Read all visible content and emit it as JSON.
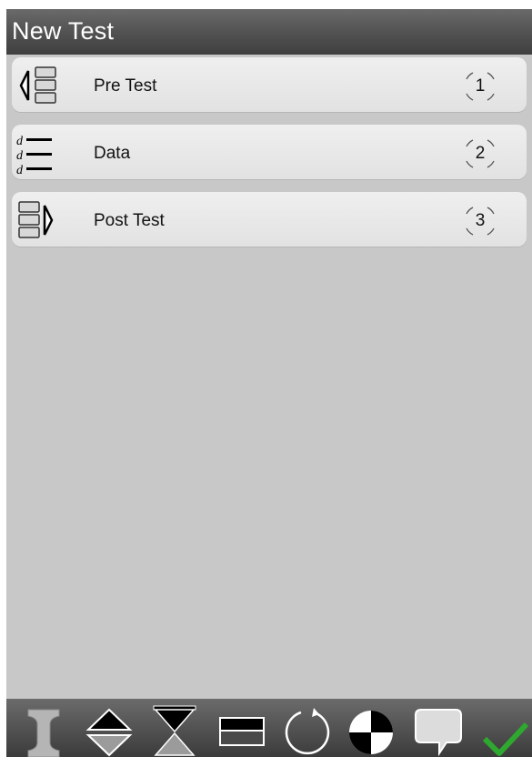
{
  "window": {
    "title": "New Test"
  },
  "steps": [
    {
      "label": "Pre Test",
      "number": "1",
      "icon": "pre-test-icon"
    },
    {
      "label": "Data",
      "number": "2",
      "icon": "data-list-icon"
    },
    {
      "label": "Post Test",
      "number": "3",
      "icon": "post-test-icon"
    }
  ],
  "data_icon_letter": "d",
  "toolbar": {
    "buttons": [
      "i-beam-icon",
      "diamond-icon",
      "hourglass-icon",
      "rectangle-icon",
      "rotate-icon",
      "pie-quadrant-icon",
      "comment-icon",
      "checkmark-icon"
    ]
  },
  "colors": {
    "title_bar": "#555555",
    "background": "#c8c8c8",
    "list_item": "#e9e9e9",
    "toolbar": "#4a4a4a",
    "accept": "#2ea82e"
  }
}
